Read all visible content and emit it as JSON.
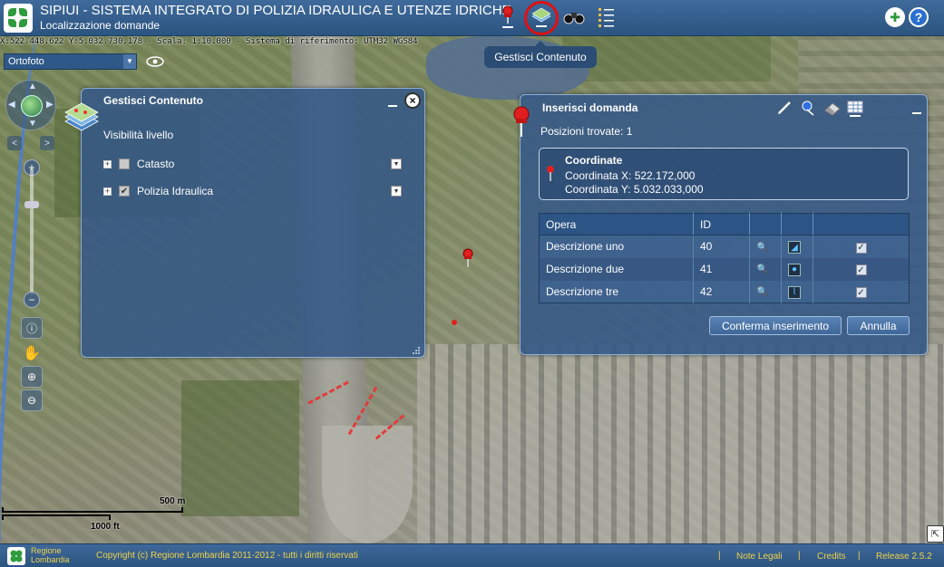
{
  "header": {
    "title": "SIPIUI - SISTEMA INTEGRATO DI POLIZIA IDRAULICA E UTENZE IDRICHE",
    "subtitle": "Localizzazione domande",
    "tools": [
      "pushpin-icon",
      "layers-icon",
      "binoculars-icon",
      "list-icon"
    ],
    "right_tools": [
      "add-icon",
      "help-icon"
    ]
  },
  "coordbar": {
    "text": "X:522.448,622 Y:5.032.730,178 - Scala: 1:10.000 - Sistema di riferimento: UTM32 WGS84"
  },
  "tooltip": {
    "text": "Gestisci Contenuto"
  },
  "basemap": {
    "selected": "Ortofoto"
  },
  "scale": {
    "metric": "500 m",
    "imperial": "1000 ft"
  },
  "layers_panel": {
    "title": "Gestisci Contenuto",
    "section_label": "Visibilità livello",
    "layers": [
      {
        "label": "Catasto",
        "checked": false
      },
      {
        "label": "Polizia Idraulica",
        "checked": true
      }
    ]
  },
  "request_panel": {
    "title": "Inserisci domanda",
    "found_label": "Posizioni trovate: 1",
    "coordinates": {
      "title": "Coordinate",
      "x": "Coordinata X: 522.172,000",
      "y": "Coordinata Y: 5.032.033,000"
    },
    "table": {
      "columns": [
        "Opera",
        "ID",
        "",
        "",
        ""
      ],
      "rows": [
        {
          "opera": "Descrizione uno",
          "id": "40"
        },
        {
          "opera": "Descrizione due",
          "id": "41"
        },
        {
          "opera": "Descrizione tre",
          "id": "42"
        }
      ]
    },
    "confirm_label": "Conferma inserimento",
    "cancel_label": "Annulla"
  },
  "footer": {
    "region_line1": "Regione",
    "region_line2": "Lombardia",
    "copyright": "Copyright (c) Regione Lombardia 2011-2012 - tutti i diritti riservati",
    "links": [
      "Note Legali",
      "Credits",
      "Release 2.5.2"
    ]
  },
  "colors": {
    "header": "#2c5480",
    "panel": "#345886",
    "footer_text": "#f0d34a",
    "highlight": "#e01010"
  }
}
